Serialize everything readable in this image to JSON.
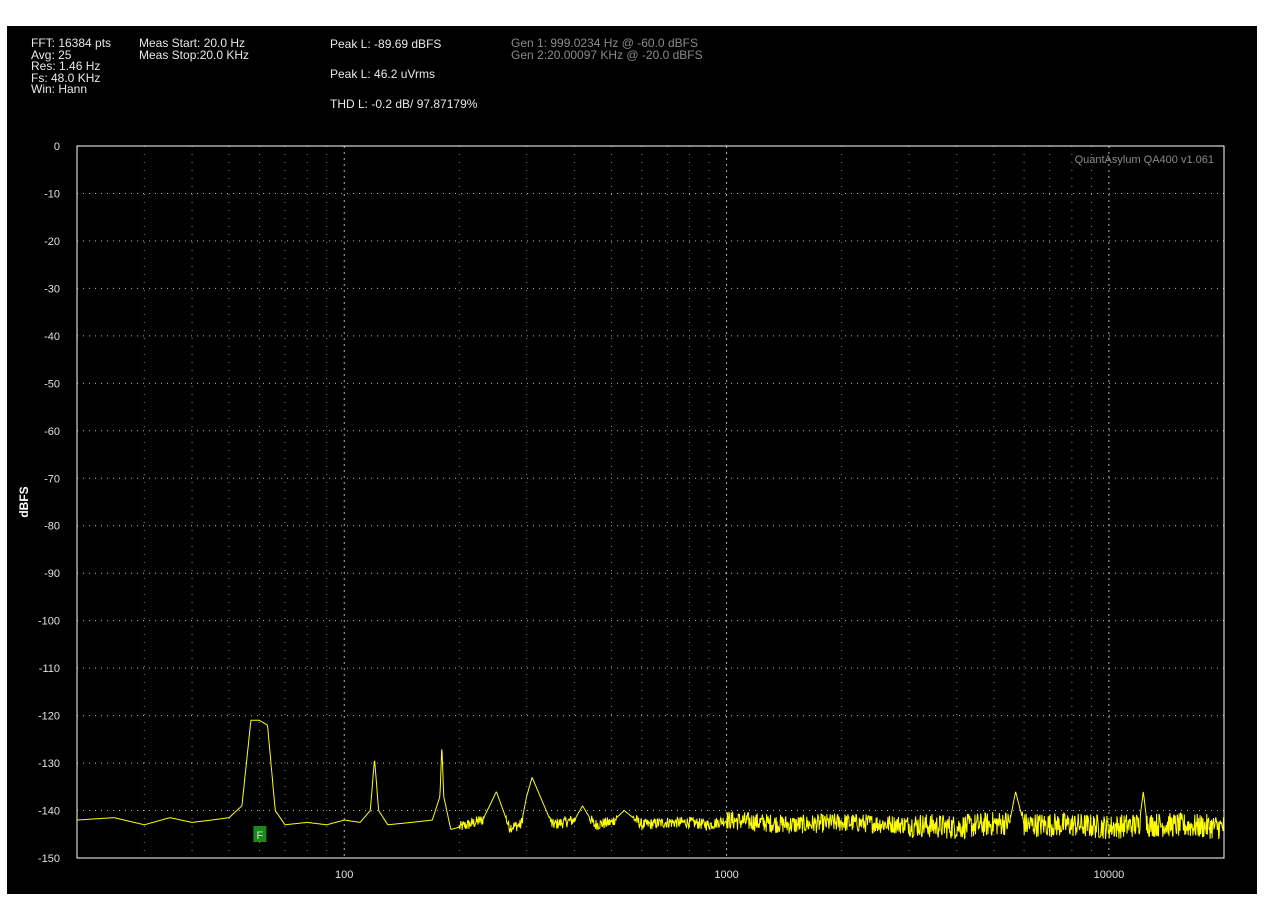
{
  "header": {
    "col1": [
      "FFT: 16384 pts",
      "Avg: 25",
      "Res: 1.46 Hz",
      "Fs: 48.0 KHz",
      "Win: Hann"
    ],
    "col2": [
      "Meas Start: 20.0 Hz",
      "Meas Stop:20.0 KHz"
    ],
    "peak_dbfs": "Peak L: -89.69 dBFS",
    "peak_vrms": "Peak L: 46.2 uVrms",
    "thd": "THD L: -0.2 dB/ 97.87179%",
    "gen1": "Gen 1: 999.0234 Hz @ -60.0  dBFS",
    "gen2": "Gen 2:20.00097 KHz @ -20.0  dBFS"
  },
  "watermark": "QuantAsylum QA400 v1.061",
  "marker": {
    "label": "F",
    "freq": 60,
    "color": "#1a8a1a"
  },
  "colors": {
    "background": "#000000",
    "trace": "#ffff00",
    "grid": "#b4b4b4",
    "axis": "#ffffff"
  },
  "chart_data": {
    "type": "line",
    "title": "",
    "xlabel": "",
    "ylabel": "dBFS",
    "xscale": "log",
    "xlim": [
      20,
      20000
    ],
    "ylim": [
      -150,
      0
    ],
    "xticks": [
      100,
      1000,
      10000
    ],
    "xtick_labels": [
      "100",
      "1000",
      "10000"
    ],
    "yticks": [
      0,
      -10,
      -20,
      -30,
      -40,
      -50,
      -60,
      -70,
      -80,
      -90,
      -100,
      -110,
      -120,
      -130,
      -140,
      -150
    ],
    "grid": true,
    "series": [
      {
        "color": "#ffff00",
        "noise_floor": -143,
        "x": [
          20,
          25,
          30,
          35,
          40,
          45,
          50,
          54,
          57,
          60,
          63,
          66,
          70,
          80,
          90,
          100,
          110,
          117,
          120,
          123,
          130,
          150,
          170,
          178,
          180,
          182,
          190,
          210,
          230,
          240,
          250,
          270,
          290,
          300,
          310,
          350,
          400,
          420,
          450,
          500,
          540,
          600,
          700,
          800,
          900,
          1000,
          1500,
          2000,
          3000,
          4000,
          5500,
          5700,
          6000,
          8000,
          10000,
          12000,
          12300,
          12600,
          14000,
          20000
        ],
        "y": [
          -142,
          -141.5,
          -143,
          -141.5,
          -142.5,
          -142,
          -141.5,
          -139,
          -121,
          -121,
          -122,
          -140,
          -143,
          -142.5,
          -143,
          -142,
          -142.5,
          -140,
          -129,
          -140,
          -143,
          -142.5,
          -142,
          -137,
          -126,
          -137,
          -144,
          -143,
          -142,
          -139,
          -136,
          -143.5,
          -143,
          -137,
          -133,
          -143,
          -142,
          -139,
          -143,
          -142.5,
          -140,
          -143,
          -142.5,
          -142.5,
          -143,
          -142,
          -143,
          -142.5,
          -143,
          -143.5,
          -142.5,
          -136,
          -143,
          -143,
          -143.5,
          -143,
          -136,
          -143,
          -143,
          -143.5
        ]
      }
    ]
  }
}
